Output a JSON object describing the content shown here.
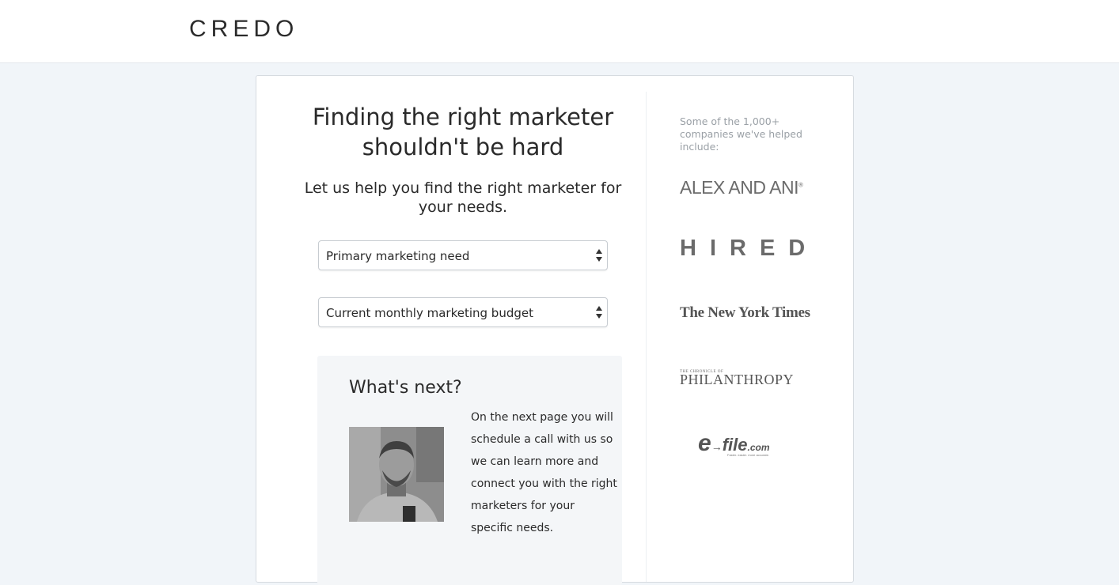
{
  "header": {
    "logo": "CREDO"
  },
  "main": {
    "headline": "Finding the right marketer shouldn't be hard",
    "subheadline": "Let us help you find the right marketer for your needs.",
    "selects": [
      {
        "selected": "Primary marketing need"
      },
      {
        "selected": "Current monthly marketing budget"
      }
    ],
    "next": {
      "title": "What's next?",
      "body": "On the next page you will schedule a call with us so we can learn more and connect you with the right marketers for your specific needs."
    }
  },
  "sidebar": {
    "intro": "Some of the 1,000+ companies we've helped include:",
    "logos": {
      "alex": "ALEX AND ANI",
      "alex_mark": "®",
      "hired": "HIRED",
      "nyt": "The New York Times",
      "philanthropy_small": "THE CHRONICLE OF",
      "philanthropy": "PHILANTHROPY",
      "efile_e": "e",
      "efile": "file",
      "efile_dotcom": ".com",
      "efile_tag": "Faster. easier. more accurate."
    }
  },
  "colors": {
    "page_background": "#f1f5f9",
    "card_background": "#ffffff",
    "panel_background": "#f4f6f8",
    "muted_text": "#9aa0a6"
  }
}
